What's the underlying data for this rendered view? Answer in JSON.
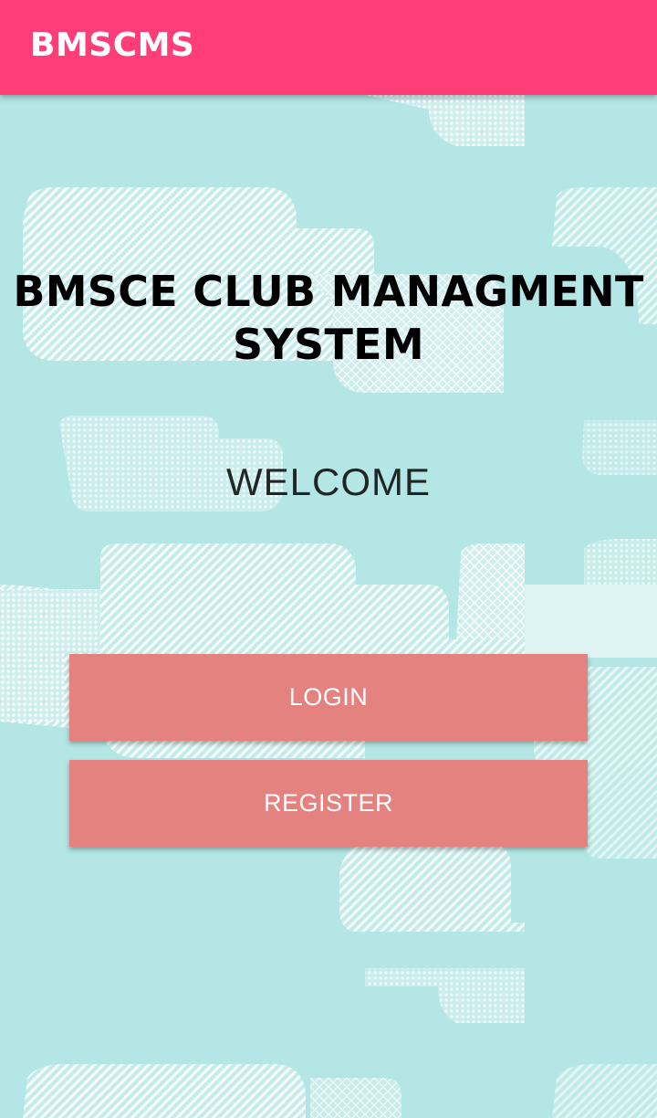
{
  "app_bar": {
    "title": "BMSCMS",
    "color": "#fe3d79"
  },
  "main": {
    "headline_line1": "BMSCE CLUB MANAGMENT",
    "headline_line2": "SYSTEM",
    "welcome": "WELCOME"
  },
  "buttons": {
    "login_label": "LOGIN",
    "register_label": "REGISTER",
    "color": "#e48280"
  },
  "background": {
    "color": "#b3e6e5",
    "pattern": "white dotted clouds"
  }
}
